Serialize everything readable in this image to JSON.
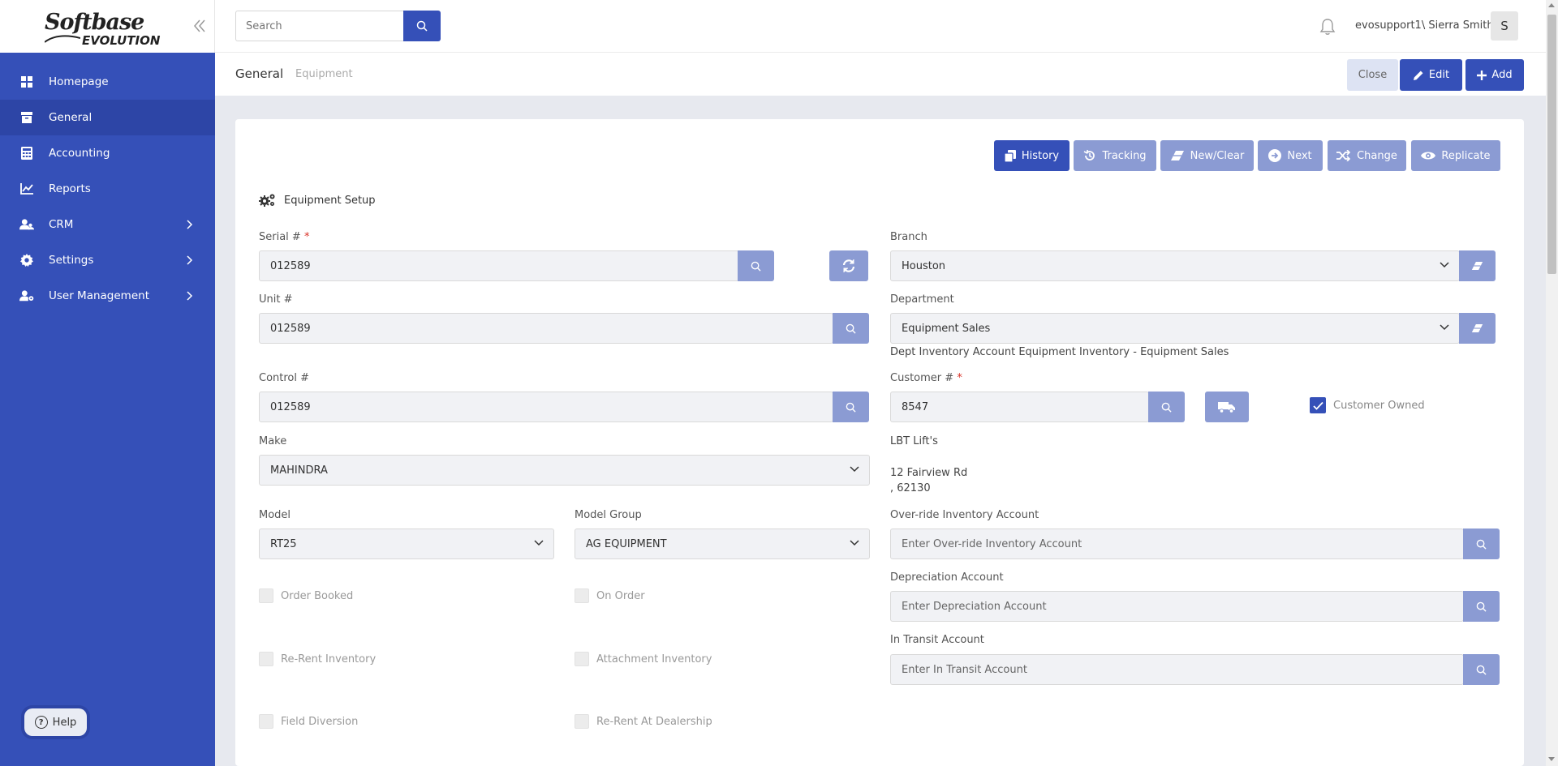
{
  "app": {
    "logo_line1": "Softbase",
    "logo_line2": "EVOLUTION"
  },
  "sidebar": {
    "items": [
      {
        "label": "Homepage",
        "icon": "dashboard-icon",
        "active": false
      },
      {
        "label": "General",
        "icon": "archive-box-icon",
        "active": true
      },
      {
        "label": "Accounting",
        "icon": "calculator-icon",
        "active": false
      },
      {
        "label": "Reports",
        "icon": "chart-line-icon",
        "active": false
      },
      {
        "label": "CRM",
        "icon": "users-icon",
        "active": false,
        "has_children": true
      },
      {
        "label": "Settings",
        "icon": "gear-icon",
        "active": false,
        "has_children": true
      },
      {
        "label": "User Management",
        "icon": "user-cog-icon",
        "active": false,
        "has_children": true
      }
    ],
    "help_label": "Help"
  },
  "topbar": {
    "search_placeholder": "Search",
    "user_name": "evosupport1\\ Sierra Smith",
    "avatar_initial": "S"
  },
  "header": {
    "breadcrumb_main": "General",
    "breadcrumb_sub": "Equipment",
    "close_label": "Close",
    "edit_label": "Edit",
    "add_label": "Add"
  },
  "toolbar": {
    "history": "History",
    "tracking": "Tracking",
    "new_clear": "New/Clear",
    "next": "Next",
    "change": "Change",
    "replicate": "Replicate"
  },
  "form": {
    "section_title": "Equipment Setup",
    "serial_label": "Serial #",
    "required_mark": "*",
    "serial_value": "012589",
    "unit_label": "Unit #",
    "unit_value": "012589",
    "control_label": "Control #",
    "control_value": "012589",
    "make_label": "Make",
    "make_value": "MAHINDRA",
    "model_label": "Model",
    "model_value": "RT25",
    "model_group_label": "Model Group",
    "model_group_value": "AG EQUIPMENT",
    "branch_label": "Branch",
    "branch_value": "Houston",
    "department_label": "Department",
    "department_value": "Equipment Sales",
    "dept_inventory_note": "Dept Inventory Account Equipment Inventory - Equipment Sales",
    "customer_label": "Customer #",
    "customer_value": "8547",
    "customer_owned_label": "Customer Owned",
    "customer_owned_checked": true,
    "customer_name": "LBT Lift's",
    "customer_address1": "12 Fairview Rd",
    "customer_address2": ", 62130",
    "override_label": "Over-ride Inventory Account",
    "override_placeholder": "Enter Over-ride Inventory Account",
    "depreciation_label": "Depreciation Account",
    "depreciation_placeholder": "Enter Depreciation Account",
    "in_transit_label": "In Transit Account",
    "in_transit_placeholder": "Enter In Transit Account",
    "checkboxes": {
      "order_booked": "Order Booked",
      "on_order": "On Order",
      "re_rent_inventory": "Re-Rent Inventory",
      "attachment_inventory": "Attachment Inventory",
      "field_diversion": "Field Diversion",
      "re_rent_at_dealership": "Re-Rent At Dealership"
    }
  },
  "colors": {
    "primary": "#3550b8",
    "primary_light": "#8b9bd3",
    "sidebar_active": "#2d45a6",
    "content_bg": "#e7e9ef"
  }
}
